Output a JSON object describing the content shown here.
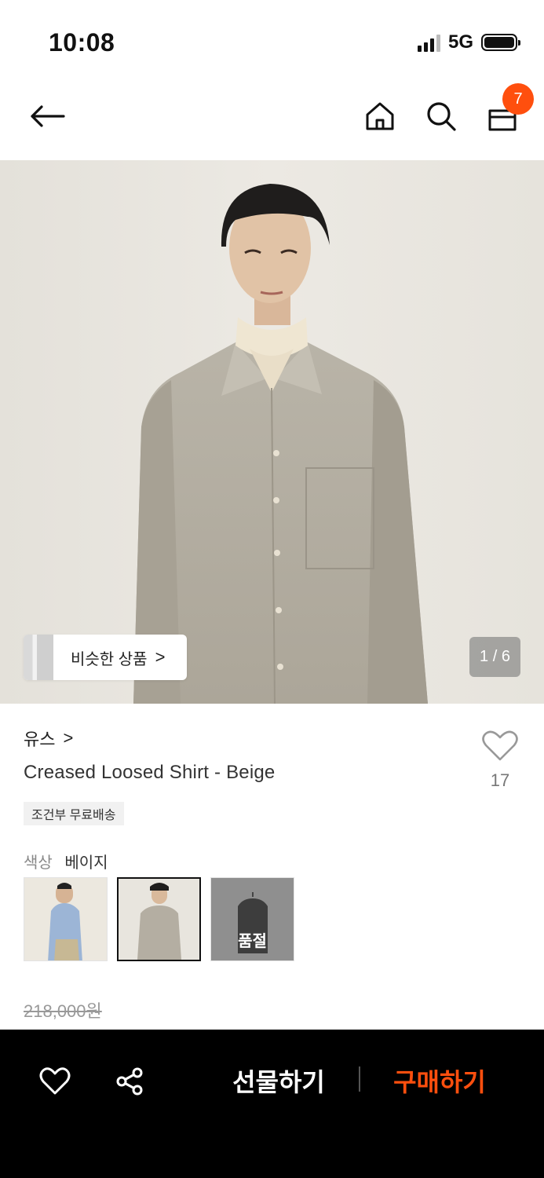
{
  "status_bar": {
    "time": "10:08",
    "network": "5G"
  },
  "nav": {
    "cart_count": "7"
  },
  "hero": {
    "similar_label": "비슷한 상품",
    "similar_chevron": ">",
    "page_indicator": "1 / 6"
  },
  "product": {
    "brand": "유스",
    "brand_chevron": ">",
    "name": "Creased Loosed Shirt - Beige",
    "like_count": "17",
    "shipping_tag": "조건부 무료배송",
    "color_label": "색상",
    "color_value": "베이지",
    "soldout_label": "품절",
    "original_price": "218,000원"
  },
  "bottom_bar": {
    "gift_label": "선물하기",
    "buy_label": "구매하기"
  },
  "colors": {
    "accent": "#ff4f0e",
    "bar": "#000000"
  }
}
